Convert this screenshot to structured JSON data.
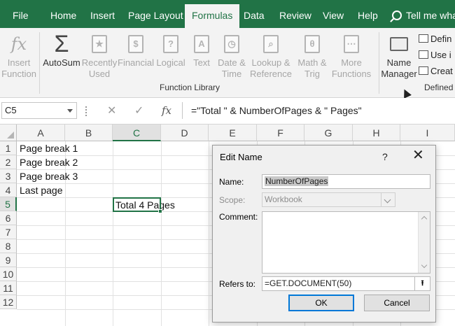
{
  "menu": {
    "tabs": [
      {
        "label": "File"
      },
      {
        "label": "Home"
      },
      {
        "label": "Insert"
      },
      {
        "label": "Page Layout"
      },
      {
        "label": "Formulas"
      },
      {
        "label": "Data"
      },
      {
        "label": "Review"
      },
      {
        "label": "View"
      },
      {
        "label": "Help"
      }
    ],
    "tell_me": "Tell me wha"
  },
  "ribbon": {
    "buttons": [
      {
        "line1": "Insert",
        "line2": "Function",
        "icon": "fx-icon"
      },
      {
        "line1": "AutoSum",
        "line2": "",
        "icon": "sigma-icon"
      },
      {
        "line1": "Recently",
        "line2": "Used",
        "icon": "star-book-icon"
      },
      {
        "line1": "Financial",
        "line2": "",
        "icon": "financial-book-icon"
      },
      {
        "line1": "Logical",
        "line2": "",
        "icon": "question-book-icon"
      },
      {
        "line1": "Text",
        "line2": "",
        "icon": "text-book-icon"
      },
      {
        "line1": "Date &",
        "line2": "Time",
        "icon": "clock-book-icon"
      },
      {
        "line1": "Lookup &",
        "line2": "Reference",
        "icon": "lookup-book-icon"
      },
      {
        "line1": "Math &",
        "line2": "Trig",
        "icon": "theta-book-icon"
      },
      {
        "line1": "More",
        "line2": "Functions",
        "icon": "more-book-icon"
      },
      {
        "line1": "Name",
        "line2": "Manager",
        "icon": "name-manager-icon"
      }
    ],
    "group_function_library": "Function Library",
    "group_defined": "Defined",
    "small_define": "Defin",
    "small_use": "Use i",
    "small_create": "Creat",
    "fx_glyph": "fx",
    "sigma_glyph": "Σ",
    "star_glyph": "★",
    "dollar_glyph": "$",
    "question_glyph": "?",
    "text_glyph": "A",
    "clock_glyph": "◷",
    "lookup_glyph": "⌕",
    "theta_glyph": "θ",
    "more_glyph": "⋯",
    "define_glyph": "≡",
    "use_glyph": "fx",
    "create_glyph": "▦"
  },
  "formula_bar": {
    "name_box": "C5",
    "cancel_glyph": "✕",
    "enter_glyph": "✓",
    "fx_glyph": "fx",
    "formula": "=\"Total \" & NumberOfPages & \" Pages\""
  },
  "grid": {
    "columns": [
      "A",
      "B",
      "C",
      "D",
      "E",
      "F",
      "G",
      "H",
      "I"
    ],
    "rows": [
      "1",
      "2",
      "3",
      "4",
      "5",
      "6",
      "7",
      "8",
      "9",
      "10",
      "11",
      "12"
    ],
    "cells": {
      "A1": "Page break 1",
      "A2": "Page break 2",
      "A3": "Page break 3",
      "A4": "Last page",
      "C5": "Total 4 Pages"
    }
  },
  "dialog": {
    "title": "Edit Name",
    "help": "?",
    "close": "✕",
    "name_label": "Name:",
    "name_value": "NumberOfPages",
    "scope_label": "Scope:",
    "scope_value": "Workbook",
    "comment_label": "Comment:",
    "comment_value": "",
    "refers_label": "Refers to:",
    "refers_value": "=GET.DOCUMENT(50)",
    "collapse_glyph": "⭱",
    "ok_label": "OK",
    "cancel_label": "Cancel"
  },
  "colors": {
    "excel_green": "#217346",
    "dialog_bg": "#f0f0f0",
    "focus_blue": "#0078d7"
  }
}
